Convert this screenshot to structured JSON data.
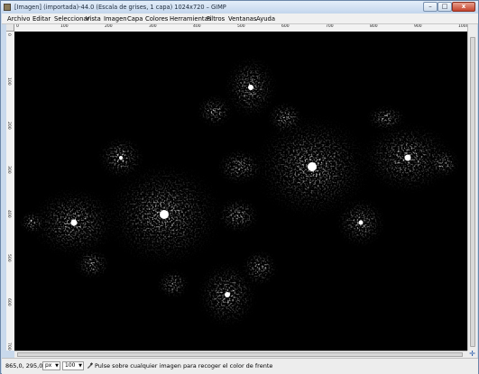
{
  "window": {
    "title": "[Imagen] (importada)-44.0 (Escala de grises, 1 capa) 1024x720 – GIMP",
    "controls": {
      "minimize": "–",
      "maximize": "□",
      "close": "x"
    }
  },
  "menu": [
    "Archivo",
    "Editar",
    "Seleccionar",
    "Vista",
    "Imagen",
    "Capa",
    "Colores",
    "Herramientas",
    "Filtros",
    "Ventanas",
    "Ayuda"
  ],
  "ruler": {
    "top_labels": [
      "0",
      "100",
      "200",
      "300",
      "400",
      "500",
      "600",
      "700",
      "800",
      "900",
      "1000"
    ],
    "left_labels": [
      "0",
      "100",
      "200",
      "300",
      "400",
      "500",
      "600",
      "700"
    ]
  },
  "status": {
    "coords": "865,0, 295,0",
    "unit": "px",
    "zoom": "100",
    "message": "Pulse sobre cualquier imagen para recoger el color de frente"
  },
  "colors": {
    "canvas_bg": "#000000",
    "fractal": "#ffffff",
    "titlebar": "#c9d9ec"
  },
  "icons": {
    "app": "gimp-icon",
    "picker": "color-picker-icon",
    "navigate": "navigate-icon"
  }
}
